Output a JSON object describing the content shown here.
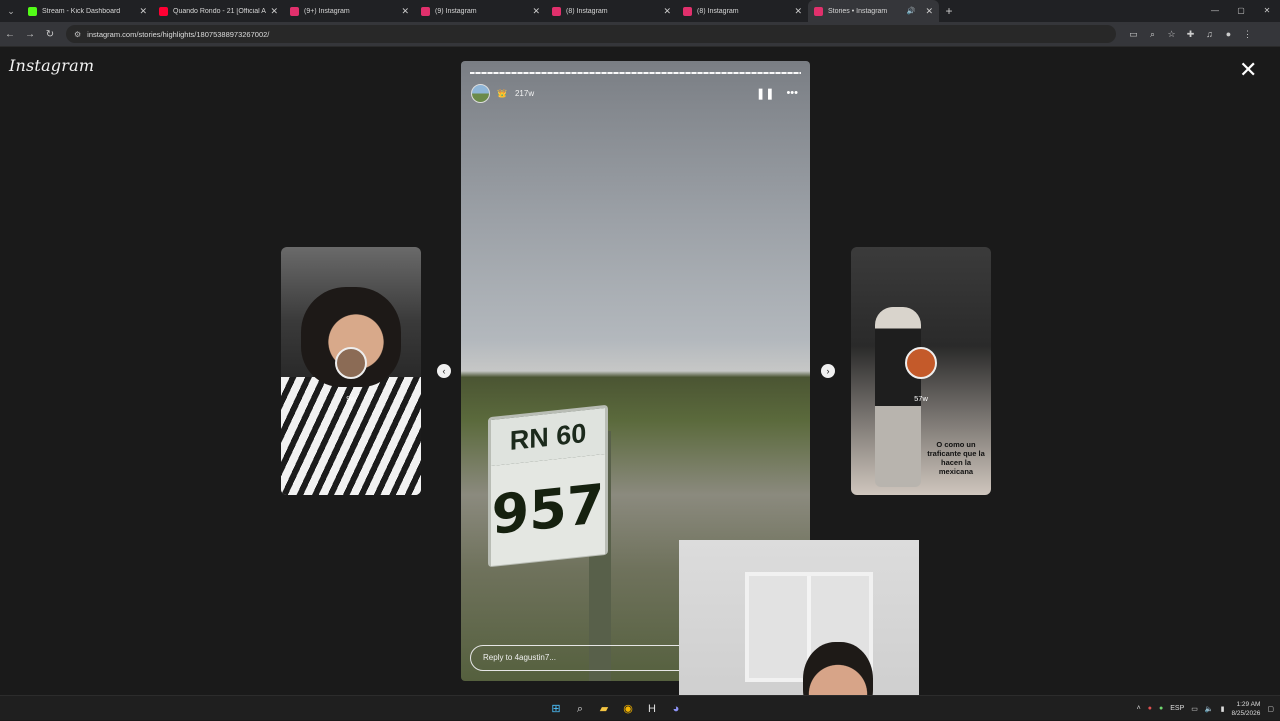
{
  "browser": {
    "tabs": [
      {
        "title": "Stream - Kick Dashboard",
        "favicon_color": "#53fc18",
        "active": false
      },
      {
        "title": "Quando Rondo - 21 [Official Au",
        "favicon_color": "#ff0033",
        "active": false
      },
      {
        "title": "(9+) Instagram",
        "favicon_color": "#e1306c",
        "active": false
      },
      {
        "title": "(9) Instagram",
        "favicon_color": "#e1306c",
        "active": false
      },
      {
        "title": "(8) Instagram",
        "favicon_color": "#e1306c",
        "active": false
      },
      {
        "title": "(8) Instagram",
        "favicon_color": "#e1306c",
        "active": false
      },
      {
        "title": "Stories • Instagram",
        "favicon_color": "#e1306c",
        "active": true
      }
    ],
    "url": "instagram.com/stories/highlights/18075388973267002/"
  },
  "page": {
    "logo": "Instagram",
    "close_icon": "close-icon",
    "story": {
      "age": "217w",
      "reply_placeholder": "Reply to 4agustin7...",
      "sign_line1": "RN 60",
      "sign_line2": "957"
    },
    "prev_story": {
      "age": "9w"
    },
    "next_story": {
      "age": "57w",
      "caption": "O como un traficante que la hacen la mexicana"
    }
  },
  "taskbar": {
    "language": "ESP",
    "time": "1:29 AM",
    "date": "8/25/2026"
  },
  "colors": {
    "background": "#1a1a1a",
    "accent": "#e1306c"
  }
}
